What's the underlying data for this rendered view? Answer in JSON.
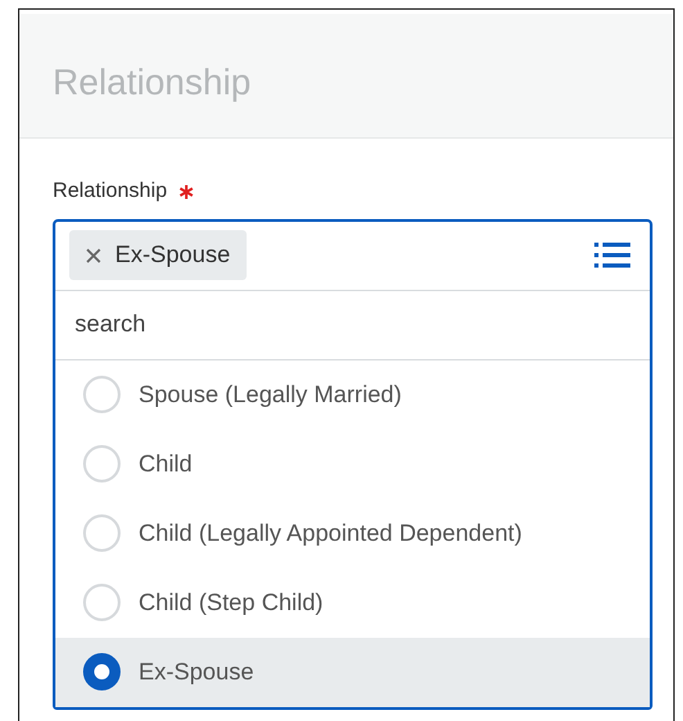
{
  "header": {
    "title": "Relationship"
  },
  "field": {
    "label": "Relationship",
    "required": true,
    "chips": [
      {
        "label": "Ex-Spouse"
      }
    ],
    "search": {
      "placeholder": "search"
    },
    "options": [
      {
        "label": "Spouse (Legally Married)",
        "selected": false
      },
      {
        "label": "Child",
        "selected": false
      },
      {
        "label": "Child (Legally Appointed Dependent)",
        "selected": false
      },
      {
        "label": "Child (Step Child)",
        "selected": false
      },
      {
        "label": "Ex-Spouse",
        "selected": true
      }
    ]
  }
}
